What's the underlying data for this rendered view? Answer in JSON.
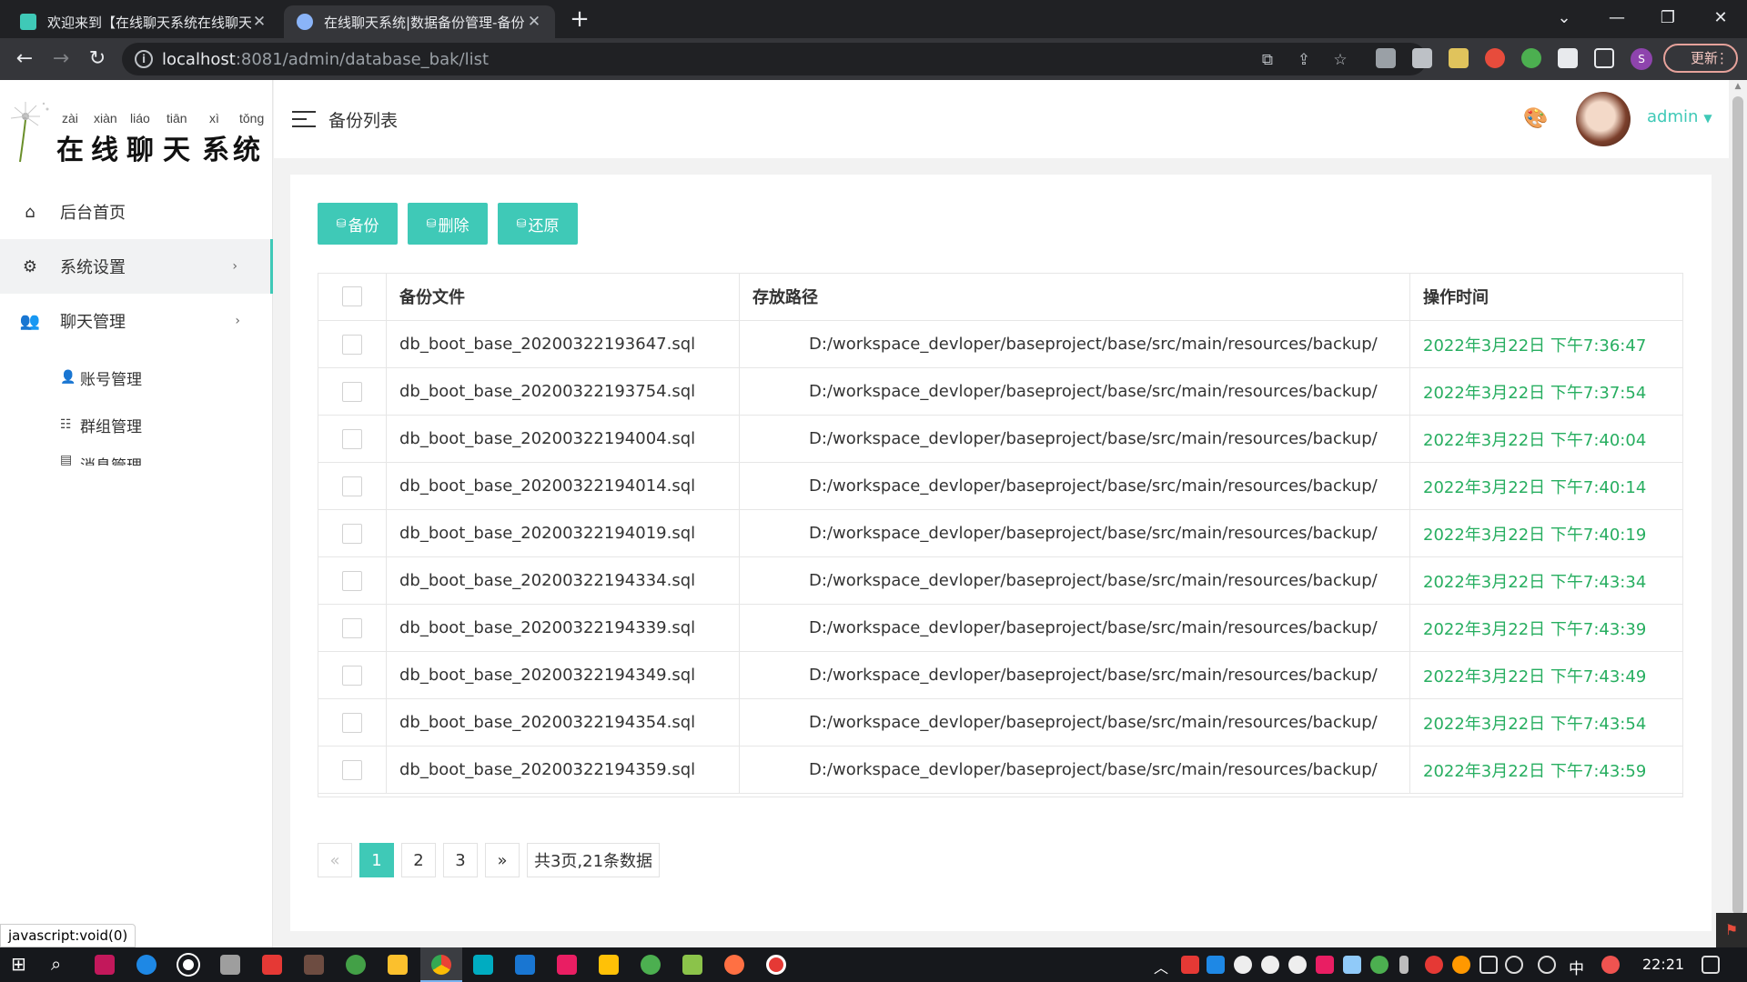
{
  "browser": {
    "tabs": [
      {
        "title": "欢迎来到【在线聊天系统在线聊天",
        "active": false
      },
      {
        "title": "在线聊天系统|数据备份管理-备份",
        "active": true
      }
    ],
    "url_host": "localhost",
    "url_rest": ":8081/admin/database_bak/list",
    "profile_initial": "S",
    "update_label": "更新",
    "status_text": "javascript:void(0)"
  },
  "sidebar": {
    "logo": {
      "pinyin": [
        "zài",
        "xiàn",
        "liáo",
        "tiān",
        "xì",
        "tǒng"
      ],
      "chars": [
        "在",
        "线",
        "聊",
        "天",
        "系",
        "统"
      ]
    },
    "menu": [
      {
        "label": "后台首页",
        "icon": "home-icon"
      },
      {
        "label": "系统设置",
        "icon": "gear-icon"
      },
      {
        "label": "聊天管理",
        "icon": "users-icon"
      }
    ],
    "submenu": [
      {
        "label": "账号管理",
        "icon": "account-icon"
      },
      {
        "label": "群组管理",
        "icon": "group-icon"
      },
      {
        "label": "消息管理",
        "icon": "message-icon"
      }
    ]
  },
  "header": {
    "title": "备份列表",
    "username": "admin"
  },
  "toolbar": {
    "backup_label": "备份",
    "delete_label": "删除",
    "restore_label": "还原"
  },
  "table": {
    "headers": [
      "备份文件",
      "存放路径",
      "操作时间"
    ],
    "rows": [
      {
        "file": "db_boot_base_20200322193647.sql",
        "path": "D:/workspace_devloper/baseproject/base/src/main/resources/backup/",
        "time": "2022年3月22日 下午7:36:47"
      },
      {
        "file": "db_boot_base_20200322193754.sql",
        "path": "D:/workspace_devloper/baseproject/base/src/main/resources/backup/",
        "time": "2022年3月22日 下午7:37:54"
      },
      {
        "file": "db_boot_base_20200322194004.sql",
        "path": "D:/workspace_devloper/baseproject/base/src/main/resources/backup/",
        "time": "2022年3月22日 下午7:40:04"
      },
      {
        "file": "db_boot_base_20200322194014.sql",
        "path": "D:/workspace_devloper/baseproject/base/src/main/resources/backup/",
        "time": "2022年3月22日 下午7:40:14"
      },
      {
        "file": "db_boot_base_20200322194019.sql",
        "path": "D:/workspace_devloper/baseproject/base/src/main/resources/backup/",
        "time": "2022年3月22日 下午7:40:19"
      },
      {
        "file": "db_boot_base_20200322194334.sql",
        "path": "D:/workspace_devloper/baseproject/base/src/main/resources/backup/",
        "time": "2022年3月22日 下午7:43:34"
      },
      {
        "file": "db_boot_base_20200322194339.sql",
        "path": "D:/workspace_devloper/baseproject/base/src/main/resources/backup/",
        "time": "2022年3月22日 下午7:43:39"
      },
      {
        "file": "db_boot_base_20200322194349.sql",
        "path": "D:/workspace_devloper/baseproject/base/src/main/resources/backup/",
        "time": "2022年3月22日 下午7:43:49"
      },
      {
        "file": "db_boot_base_20200322194354.sql",
        "path": "D:/workspace_devloper/baseproject/base/src/main/resources/backup/",
        "time": "2022年3月22日 下午7:43:54"
      },
      {
        "file": "db_boot_base_20200322194359.sql",
        "path": "D:/workspace_devloper/baseproject/base/src/main/resources/backup/",
        "time": "2022年3月22日 下午7:43:59"
      }
    ]
  },
  "pagination": {
    "prev": "«",
    "pages": [
      "1",
      "2",
      "3"
    ],
    "current": "1",
    "next": "»",
    "summary": "共3页,21条数据"
  },
  "taskbar": {
    "ime": "中",
    "clock": "22:21"
  },
  "colors": {
    "accent": "#3fc9b7",
    "time_text": "#27ae60"
  }
}
